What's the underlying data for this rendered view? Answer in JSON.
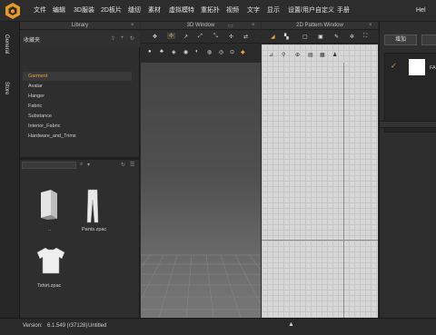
{
  "menubar": {
    "items": [
      "文件",
      "编辑",
      "3D服装",
      "2D板片",
      "缝纫",
      "素材",
      "虚拟模特",
      "重拓扑",
      "视频",
      "文字",
      "显示",
      "设置/用户自定义",
      "手册"
    ],
    "user_label": "Hel"
  },
  "vertical_tabs": {
    "general": "General",
    "store": "Store"
  },
  "library": {
    "title": "Library",
    "favorites_label": "收藏夹",
    "tree": [
      "Garment",
      "Avatar",
      "Hanger",
      "Fabric",
      "Substance",
      "Interior_Fabric",
      "Hardware_and_Trims"
    ],
    "selected_item": "Garment",
    "files": [
      {
        "name": ".."
      },
      {
        "name": "Pants.zpac"
      },
      {
        "name": "Tshirt.zpac"
      }
    ]
  },
  "window3d": {
    "title": "3D Window"
  },
  "window2d": {
    "title": "2D Pattern Window"
  },
  "right_panel": {
    "add_label": "增加",
    "fabric_name": "FA"
  },
  "status": {
    "version_label": "Version:",
    "version_value": "6.1.549 (r37128)",
    "file_name": "Untitled"
  },
  "colors": {
    "accent": "#e8a23a",
    "background": "#2b2b2b"
  }
}
